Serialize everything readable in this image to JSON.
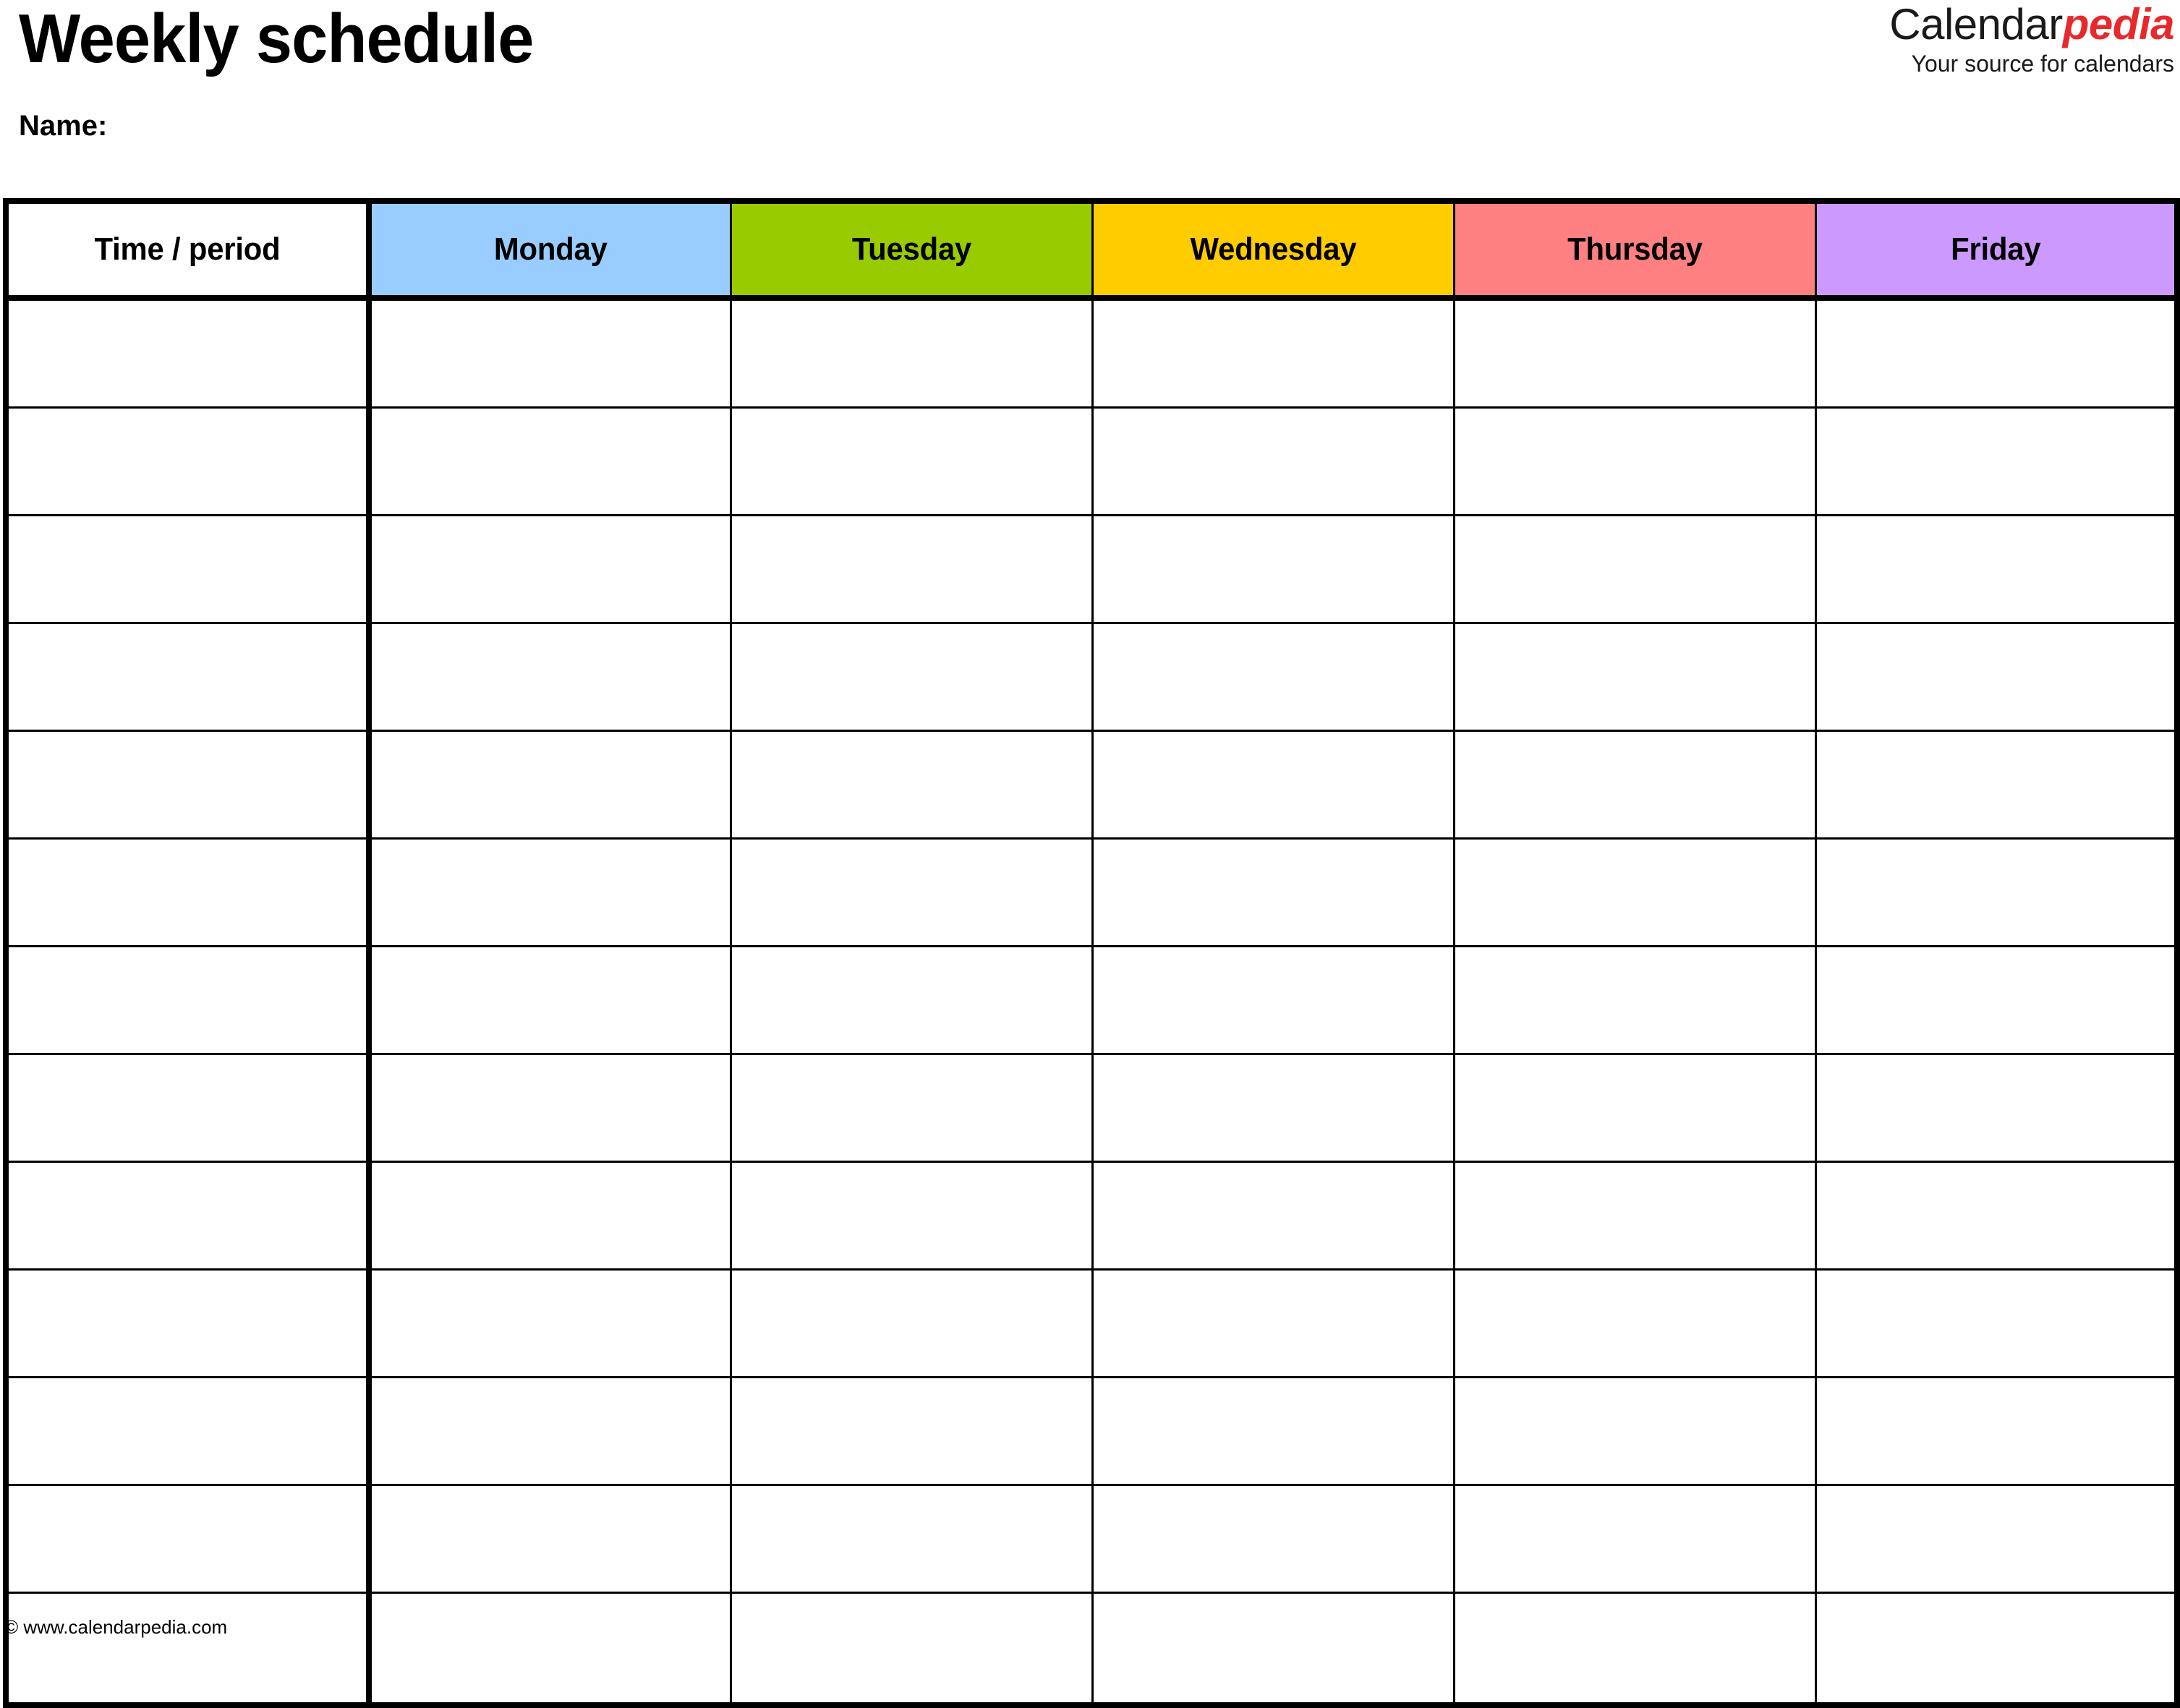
{
  "document": {
    "title": "Weekly schedule",
    "name_label": "Name:"
  },
  "brand": {
    "word_primary": "Calendar",
    "word_accent": "pedia",
    "tagline": "Your source for calendars",
    "accent_color": "#e8292c",
    "primary_color": "#1a1a1a"
  },
  "schedule": {
    "columns": [
      {
        "id": "time",
        "label": "Time / period",
        "bg": "#ffffff"
      },
      {
        "id": "monday",
        "label": "Monday",
        "bg": "#99ccff"
      },
      {
        "id": "tuesday",
        "label": "Tuesday",
        "bg": "#99cc00"
      },
      {
        "id": "wednesday",
        "label": "Wednesday",
        "bg": "#ffcc00"
      },
      {
        "id": "thursday",
        "label": "Thursday",
        "bg": "#ff8080"
      },
      {
        "id": "friday",
        "label": "Friday",
        "bg": "#cc99ff"
      }
    ],
    "row_count": 13,
    "rows": [
      {
        "time": "",
        "monday": "",
        "tuesday": "",
        "wednesday": "",
        "thursday": "",
        "friday": ""
      },
      {
        "time": "",
        "monday": "",
        "tuesday": "",
        "wednesday": "",
        "thursday": "",
        "friday": ""
      },
      {
        "time": "",
        "monday": "",
        "tuesday": "",
        "wednesday": "",
        "thursday": "",
        "friday": ""
      },
      {
        "time": "",
        "monday": "",
        "tuesday": "",
        "wednesday": "",
        "thursday": "",
        "friday": ""
      },
      {
        "time": "",
        "monday": "",
        "tuesday": "",
        "wednesday": "",
        "thursday": "",
        "friday": ""
      },
      {
        "time": "",
        "monday": "",
        "tuesday": "",
        "wednesday": "",
        "thursday": "",
        "friday": ""
      },
      {
        "time": "",
        "monday": "",
        "tuesday": "",
        "wednesday": "",
        "thursday": "",
        "friday": ""
      },
      {
        "time": "",
        "monday": "",
        "tuesday": "",
        "wednesday": "",
        "thursday": "",
        "friday": ""
      },
      {
        "time": "",
        "monday": "",
        "tuesday": "",
        "wednesday": "",
        "thursday": "",
        "friday": ""
      },
      {
        "time": "",
        "monday": "",
        "tuesday": "",
        "wednesday": "",
        "thursday": "",
        "friday": ""
      },
      {
        "time": "",
        "monday": "",
        "tuesday": "",
        "wednesday": "",
        "thursday": "",
        "friday": ""
      },
      {
        "time": "",
        "monday": "",
        "tuesday": "",
        "wednesday": "",
        "thursday": "",
        "friday": ""
      },
      {
        "time": "",
        "monday": "",
        "tuesday": "",
        "wednesday": "",
        "thursday": "",
        "friday": ""
      }
    ]
  },
  "footer": {
    "credit": "© www.calendarpedia.com"
  }
}
